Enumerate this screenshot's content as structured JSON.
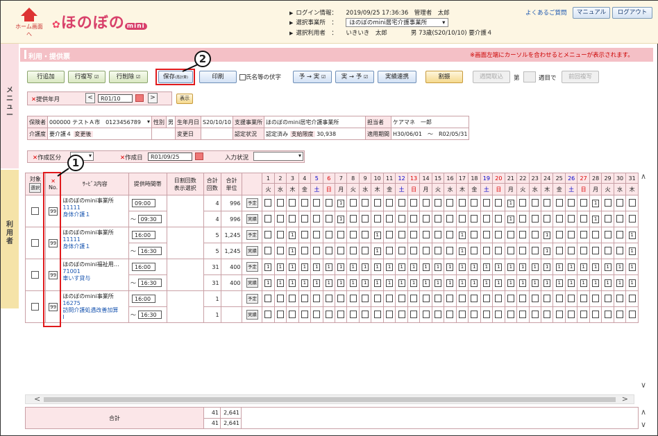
{
  "header": {
    "home_label": "ホーム画面へ",
    "logo_text": "ほのぼの",
    "logo_suffix": "mini",
    "login_label": "ログイン情報：",
    "login_value": "2019/09/25 17:36:36　管理者　太郎",
    "office_label": "選択事業所",
    "office_value": "ほのぼのmini居宅介護事業所",
    "user_label": "選択利用者",
    "user_value": "いきいき　太郎　　　　男 73歳(S20/10/10) 要介護４",
    "faq": "よくあるご質問",
    "manual": "マニュアル",
    "logout": "ログアウト"
  },
  "rail": {
    "menu": "メニュー",
    "user": "利用者"
  },
  "title": "利用・提供票",
  "notice": "※画面左端にカーソルを合わせるとメニューが表示されます。",
  "toolbar": {
    "add_row": "行追加",
    "copy_row": "行複写",
    "delete_row": "行削除",
    "save": "保存",
    "save_sub": "(再計算)",
    "print": "印刷",
    "name_mask": "氏名等の伏字",
    "plan_to_actual": "予 → 実",
    "actual_to_plan": "実 → 予",
    "actual_link": "実績連携",
    "allocate": "割振",
    "weekly_import": "週間取込",
    "week_prefix": "第",
    "week_suffix": "週目で",
    "prev_copy": "前回複写"
  },
  "callouts": [
    "1",
    "2"
  ],
  "month": {
    "label": "提供年月",
    "value": "R01/10",
    "display_btn": "表示"
  },
  "info": {
    "insured_label": "保険者",
    "insured_value": "000000 テストＡ市　0123456789",
    "sex_label": "性別",
    "sex_value": "男",
    "birth_label": "生年月日",
    "birth_value": "S20/10/10",
    "support_label": "支援事業所",
    "support_value": "ほのぼのmini居宅介護事業所",
    "cm_label": "担当者",
    "cm_value": "ケアマネ　一郎",
    "care_label": "介護度",
    "care_value": "要介護４",
    "change_label": "変更後",
    "change_value": "",
    "change_date_label": "変更日",
    "change_date_value": "",
    "cert_label": "認定状況",
    "cert_value": "認定済み",
    "limit_label": "支給限度",
    "limit_value": "30,938",
    "period_label": "適用期間",
    "period_from": "H30/06/01",
    "period_sep": "〜",
    "period_to": "R02/05/31"
  },
  "create": {
    "type_label": "作成区分",
    "date_label": "作成日",
    "date_value": "R01/09/25",
    "status_label": "入力状況"
  },
  "grid": {
    "col_target": "対象",
    "col_select": "選択",
    "col_no": "No.",
    "col_service": "ｻｰﾋﾞｽ内容",
    "col_time": "提供時間帯",
    "col_daily": "日割回数\n表示選択",
    "col_total_count": "合計\n回数",
    "col_total_unit": "合計\n単位",
    "days": [
      "1",
      "2",
      "3",
      "4",
      "5",
      "6",
      "7",
      "8",
      "9",
      "10",
      "11",
      "12",
      "13",
      "14",
      "15",
      "16",
      "17",
      "18",
      "19",
      "20",
      "21",
      "22",
      "23",
      "24",
      "25",
      "26",
      "27",
      "28",
      "29",
      "30",
      "31"
    ],
    "weekdays": [
      "火",
      "水",
      "木",
      "金",
      "土",
      "日",
      "月",
      "火",
      "水",
      "木",
      "金",
      "土",
      "日",
      "月",
      "火",
      "水",
      "木",
      "金",
      "土",
      "日",
      "月",
      "火",
      "水",
      "木",
      "金",
      "土",
      "日",
      "月",
      "火",
      "水",
      "木"
    ],
    "plan_label": "予定",
    "actual_label": "実績",
    "rows": [
      {
        "no": "99",
        "office": "ほのぼのmini事業所",
        "code": "11111",
        "service": "身体介護１",
        "start": "09:00",
        "end": "09:30",
        "plan_count": "4",
        "plan_unit": "996",
        "act_count": "4",
        "act_unit": "996",
        "plan_days": [
          "",
          "",
          "",
          "",
          "",
          "",
          "1",
          "",
          "",
          "",
          "",
          "",
          "",
          "",
          "",
          "",
          "",
          "",
          "",
          "",
          "1",
          "",
          "",
          "",
          "",
          "",
          "",
          "1",
          "",
          "",
          ""
        ],
        "act_days": [
          "",
          "",
          "",
          "",
          "",
          "",
          "1",
          "",
          "",
          "",
          "",
          "",
          "",
          "",
          "",
          "",
          "",
          "",
          "",
          "",
          "1",
          "",
          "",
          "",
          "",
          "",
          "",
          "1",
          "",
          "",
          ""
        ]
      },
      {
        "no": "99",
        "office": "ほのぼのmini事業所",
        "code": "11111",
        "service": "身体介護１",
        "start": "16:00",
        "end": "16:30",
        "plan_count": "5",
        "plan_unit": "1,245",
        "act_count": "5",
        "act_unit": "1,245",
        "plan_days": [
          "",
          "",
          "1",
          "",
          "",
          "",
          "",
          "",
          "",
          "1",
          "",
          "",
          "",
          "",
          "",
          "",
          "1",
          "",
          "",
          "",
          "",
          "",
          "",
          "1",
          "",
          "",
          "",
          "",
          "",
          "",
          "1"
        ],
        "act_days": [
          "",
          "",
          "1",
          "",
          "",
          "",
          "",
          "",
          "",
          "1",
          "",
          "",
          "",
          "",
          "",
          "",
          "1",
          "",
          "",
          "",
          "",
          "",
          "",
          "1",
          "",
          "",
          "",
          "",
          "",
          "",
          "1"
        ]
      },
      {
        "no": "99",
        "office": "ほのぼのmini福祉用…",
        "code": "71001",
        "service": "車いす貸与",
        "start": "16:00",
        "end": "16:30",
        "plan_count": "31",
        "plan_unit": "400",
        "act_count": "31",
        "act_unit": "400",
        "plan_days": [
          "1",
          "1",
          "1",
          "1",
          "1",
          "1",
          "1",
          "1",
          "1",
          "1",
          "1",
          "1",
          "1",
          "1",
          "1",
          "1",
          "1",
          "1",
          "1",
          "1",
          "1",
          "1",
          "1",
          "1",
          "1",
          "1",
          "1",
          "1",
          "1",
          "1",
          "1"
        ],
        "act_days": [
          "1",
          "1",
          "1",
          "1",
          "1",
          "1",
          "1",
          "1",
          "1",
          "1",
          "1",
          "1",
          "1",
          "1",
          "1",
          "1",
          "1",
          "1",
          "1",
          "1",
          "1",
          "1",
          "1",
          "1",
          "1",
          "1",
          "1",
          "1",
          "1",
          "1",
          "1"
        ]
      },
      {
        "no": "99",
        "office": "ほのぼのmini事業所",
        "code": "16275",
        "service": "訪問介護処遇改善加算",
        "service2": "Ⅰ",
        "start": "16:00",
        "end": "16:30",
        "plan_count": "1",
        "plan_unit": "",
        "act_count": "1",
        "act_unit": "",
        "plan_days": [
          "",
          "",
          "",
          "",
          "",
          "",
          "",
          "",
          "",
          "",
          "",
          "",
          "",
          "",
          "",
          "",
          "",
          "",
          "",
          "",
          "",
          "",
          "",
          "",
          "",
          "",
          "",
          "",
          "",
          "",
          ""
        ],
        "act_days": [
          "",
          "",
          "",
          "",
          "",
          "",
          "",
          "",
          "",
          "",
          "",
          "",
          "",
          "",
          "",
          "",
          "",
          "",
          "",
          "",
          "",
          "",
          "",
          "",
          "",
          "",
          "",
          "",
          "",
          "",
          ""
        ]
      }
    ]
  },
  "footer": {
    "total_label": "合計",
    "row1_count": "41",
    "row1_unit": "2,641",
    "row2_count": "41",
    "row2_unit": "2,641"
  }
}
